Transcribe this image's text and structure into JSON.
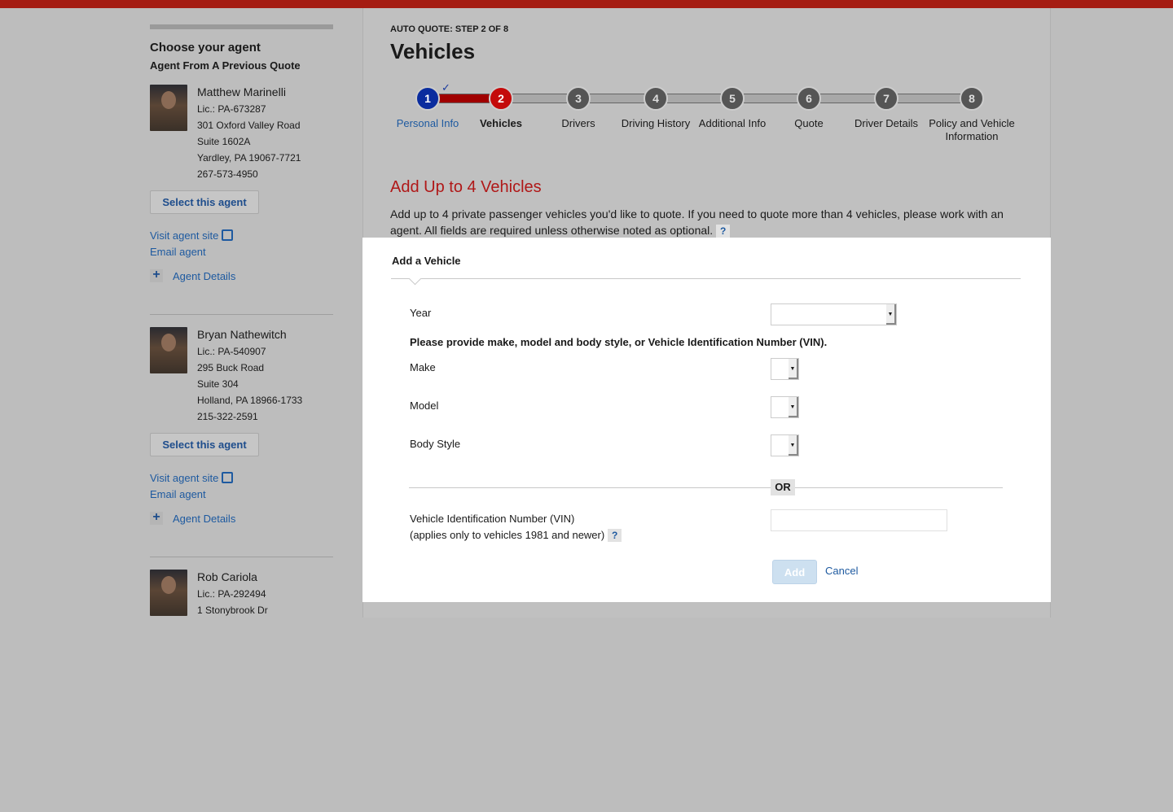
{
  "header": {
    "step_label": "AUTO QUOTE: STEP 2 OF 8",
    "title": "Vehicles"
  },
  "progress": {
    "steps": [
      {
        "num": "1",
        "label": "Personal Info",
        "state": "done"
      },
      {
        "num": "2",
        "label": "Vehicles",
        "state": "current"
      },
      {
        "num": "3",
        "label": "Drivers"
      },
      {
        "num": "4",
        "label": "Driving History"
      },
      {
        "num": "5",
        "label": "Additional Info"
      },
      {
        "num": "6",
        "label": "Quote"
      },
      {
        "num": "7",
        "label": "Driver Details"
      },
      {
        "num": "8",
        "label": "Policy and Vehicle Information"
      }
    ],
    "check": "✓"
  },
  "sidebar": {
    "title": "Choose your agent",
    "subtitle": "Agent From A Previous Quote",
    "agents": [
      {
        "name": "Matthew Marinelli",
        "lic": "Lic.: PA-673287",
        "addr1": "301 Oxford Valley Road",
        "addr2": "Suite 1602A",
        "city": "Yardley, PA 19067-7721",
        "phone": "267-573-4950"
      },
      {
        "name": "Bryan Nathewitch",
        "lic": "Lic.: PA-540907",
        "addr1": "295 Buck Road",
        "addr2": "Suite 304",
        "city": "Holland, PA 18966-1733",
        "phone": "215-322-2591"
      },
      {
        "name": "Rob Cariola",
        "lic": "Lic.: PA-292494",
        "addr1": "1 Stonybrook Dr"
      }
    ],
    "select_label": "Select this agent",
    "visit_label": "Visit agent site",
    "email_label": "Email agent",
    "details_label": "Agent Details",
    "plus": "+"
  },
  "section": {
    "title": "Add Up to 4 Vehicles",
    "intro": "Add up to 4 private passenger vehicles you'd like to quote. If you need to quote more than 4 vehicles, please work with an agent. All fields are required unless otherwise noted as optional.",
    "help": "?"
  },
  "form": {
    "title": "Add a Vehicle",
    "year_label": "Year",
    "instruction": "Please provide make, model and body style, or Vehicle Identification Number (VIN).",
    "make_label": "Make",
    "model_label": "Model",
    "body_label": "Body Style",
    "or_label": "OR",
    "vin_label": "Vehicle Identification Number (VIN)",
    "vin_note": "(applies only to vehicles 1981 and newer)",
    "help": "?",
    "add_label": "Add",
    "cancel_label": "Cancel",
    "arrow": "▼"
  }
}
